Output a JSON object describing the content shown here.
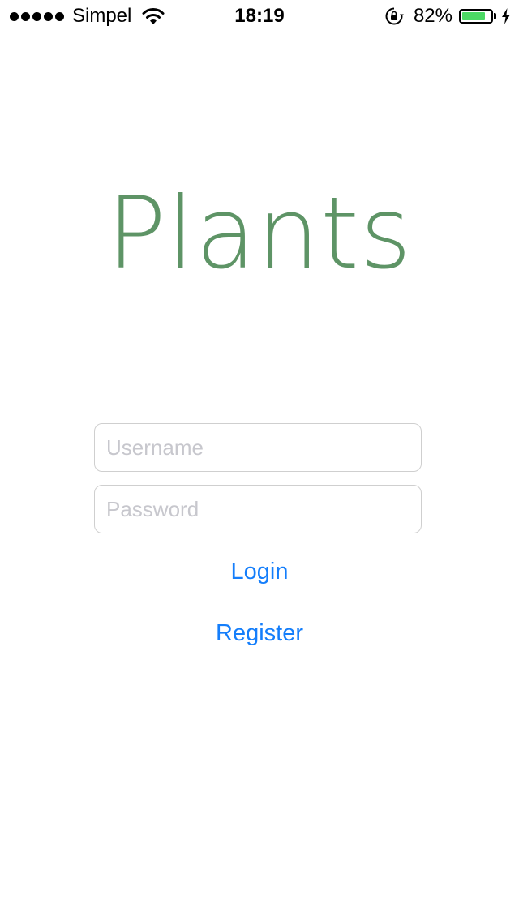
{
  "status_bar": {
    "carrier": "Simpel",
    "signal_strength": 5,
    "time": "18:19",
    "battery_percent": "82%",
    "battery_level": 0.82,
    "icons": [
      "signal-dots-icon",
      "wifi-icon",
      "rotation-lock-icon",
      "battery-icon",
      "charging-bolt-icon"
    ]
  },
  "app": {
    "title": "Plants"
  },
  "form": {
    "username": {
      "value": "",
      "placeholder": "Username"
    },
    "password": {
      "value": "",
      "placeholder": "Password"
    },
    "login_label": "Login",
    "register_label": "Register"
  },
  "colors": {
    "title": "#5e9466",
    "link": "#147efb",
    "battery_fill": "#4cd964",
    "field_border": "#cfcfcf",
    "placeholder": "#c7c7cd"
  }
}
